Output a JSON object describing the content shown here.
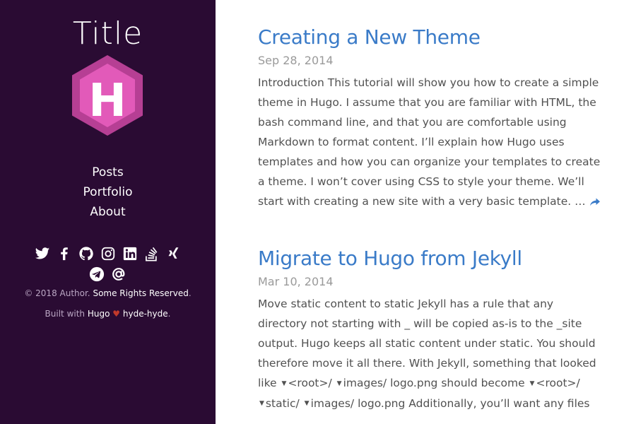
{
  "sidebar": {
    "title": "Title",
    "logo_letter": "H",
    "nav": [
      {
        "label": "Posts"
      },
      {
        "label": "Portfolio"
      },
      {
        "label": "About"
      }
    ],
    "social_icons": [
      "twitter-icon",
      "facebook-icon",
      "github-icon",
      "instagram-icon",
      "linkedin-icon",
      "stackoverflow-icon",
      "xing-icon",
      "telegram-icon",
      "email-icon"
    ],
    "copyright_prefix": "© 2018 Author.",
    "copyright_link": "Some Rights Reserved",
    "copyright_suffix": ".",
    "built_prefix": "Built with",
    "built_hugo": "Hugo",
    "built_heart": "♥",
    "built_theme": "hyde-hyde",
    "built_suffix": "."
  },
  "posts": [
    {
      "title": "Creating a New Theme",
      "date": "Sep 28, 2014",
      "summary": "Introduction This tutorial will show you how to create a simple theme in Hugo. I assume that you are familiar with HTML, the bash command line, and that you are comfortable using Markdown to format content. I’ll explain how Hugo uses templates and how you can organize your templates to create a theme. I won’t cover using CSS to style your theme. We’ll start with creating a new site with a very basic template. …"
    },
    {
      "title": "Migrate to Hugo from Jekyll",
      "date": "Mar 10, 2014",
      "summary_part1": "Move static content to static Jekyll has a rule that any directory not starting with _ will be copied as-is to the _site output. Hugo keeps all static content under static. You should therefore move it all there. With Jekyll, something that looked like",
      "path_a": [
        "<root>/",
        "images/",
        "logo.png"
      ],
      "summary_part2": "should become",
      "path_b": [
        "<root>/",
        "static/",
        "images/",
        "logo.png"
      ],
      "summary_part3": "Additionally, you’ll want any files"
    }
  ],
  "colors": {
    "sidebar_bg": "#2a0b33",
    "link": "#3a7bc8",
    "logo_outer": "#b63f94",
    "logo_inner": "#e25ab9"
  }
}
